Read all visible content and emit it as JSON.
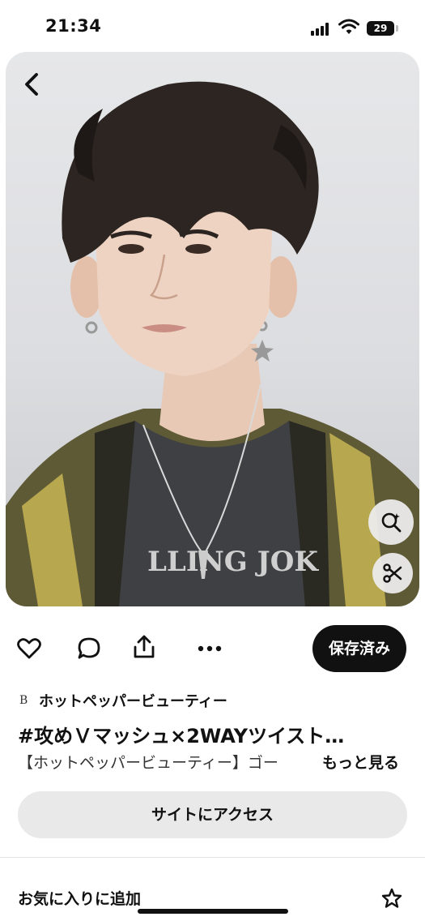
{
  "status_bar": {
    "time": "21:34",
    "battery_level": "29",
    "icons": [
      "cellular-signal-icon",
      "wifi-icon",
      "battery-icon"
    ]
  },
  "hero": {
    "description": "portrait photo",
    "icons": [
      "back-arrow-icon",
      "visual-search-icon",
      "scissors-icon"
    ]
  },
  "actions": {
    "icons": [
      "heart-icon",
      "comment-icon",
      "share-icon",
      "more-icon"
    ],
    "saved_label": "保存済み"
  },
  "pin": {
    "source_logo": "B",
    "source_name": "ホットペッパービューティー",
    "title": "#攻めＶマッシュ×2WAYツイスト…",
    "description": "【ホットペッパービューティー】ゴー",
    "more_label": "もっと見る"
  },
  "visit_site_label": "サイトにアクセス",
  "favorite": {
    "label": "お気に入りに追加",
    "icon": "star-icon"
  },
  "colors": {
    "primary_button": "#111111",
    "secondary_button": "#e9e9e9",
    "background": "#ffffff"
  }
}
